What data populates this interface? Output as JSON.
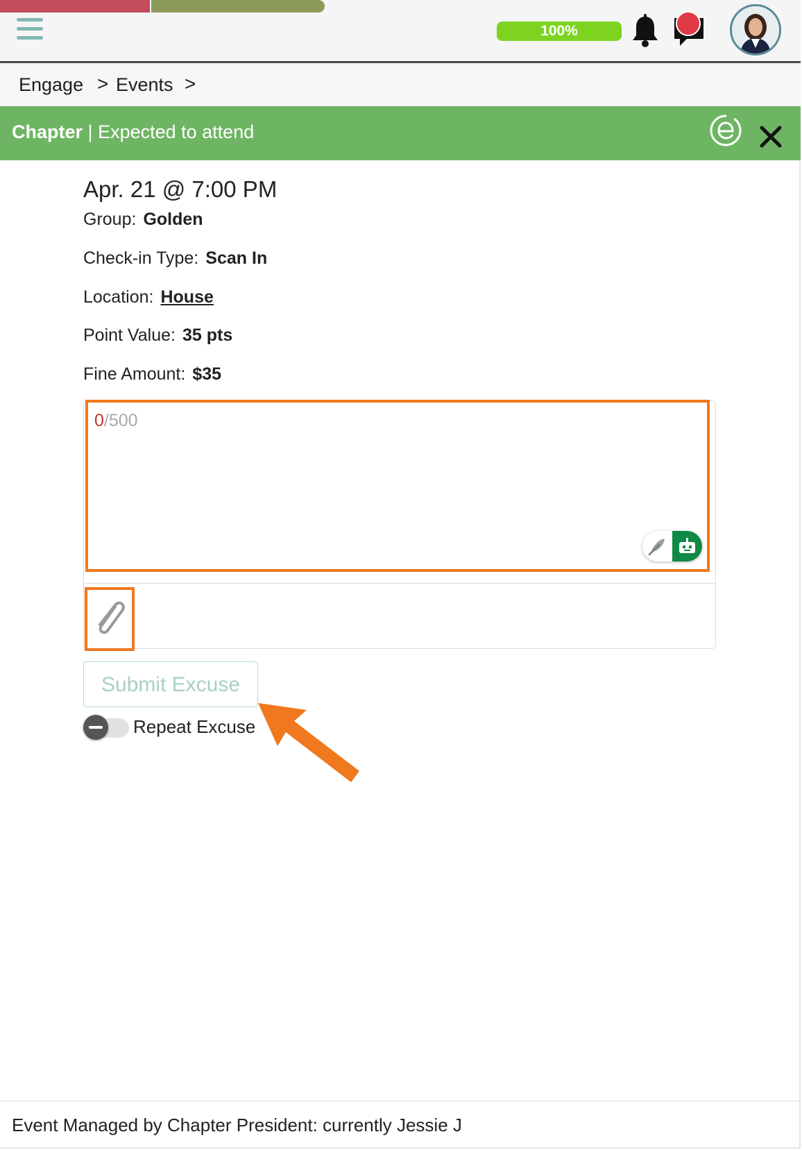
{
  "topbar": {
    "progress_label": "100%",
    "colors": {
      "progress_red": "#c24c5a",
      "progress_olive": "#8c9a5a",
      "pill_green": "#7ed321"
    },
    "progress_fraction": 1.0
  },
  "breadcrumb": {
    "items": [
      {
        "label": "Engage"
      },
      {
        "label": "Events"
      }
    ],
    "separator": ">"
  },
  "header": {
    "title": "Chapter",
    "separator": "|",
    "subtitle": "Expected to attend",
    "color": "#6eb563"
  },
  "event": {
    "datetime": "Apr. 21 @ 7:00 PM",
    "details": [
      {
        "label": "Group:",
        "value": "Golden",
        "link": false
      },
      {
        "label": "Check-in Type:",
        "value": "Scan In",
        "link": false
      },
      {
        "label": "Location:",
        "value": "House",
        "link": true
      },
      {
        "label": "Point Value:",
        "value": "35 pts",
        "link": false
      },
      {
        "label": "Fine Amount:",
        "value": "$35",
        "link": false
      }
    ]
  },
  "editor": {
    "counter_current": "0",
    "counter_sep": "/",
    "counter_max": "500",
    "highlight_color": "#f0781e"
  },
  "actions": {
    "submit_label": "Submit Excuse",
    "repeat_label": "Repeat Excuse",
    "repeat_enabled": false
  },
  "footer": {
    "text": "Event Managed by Chapter President: currently Jessie J"
  }
}
